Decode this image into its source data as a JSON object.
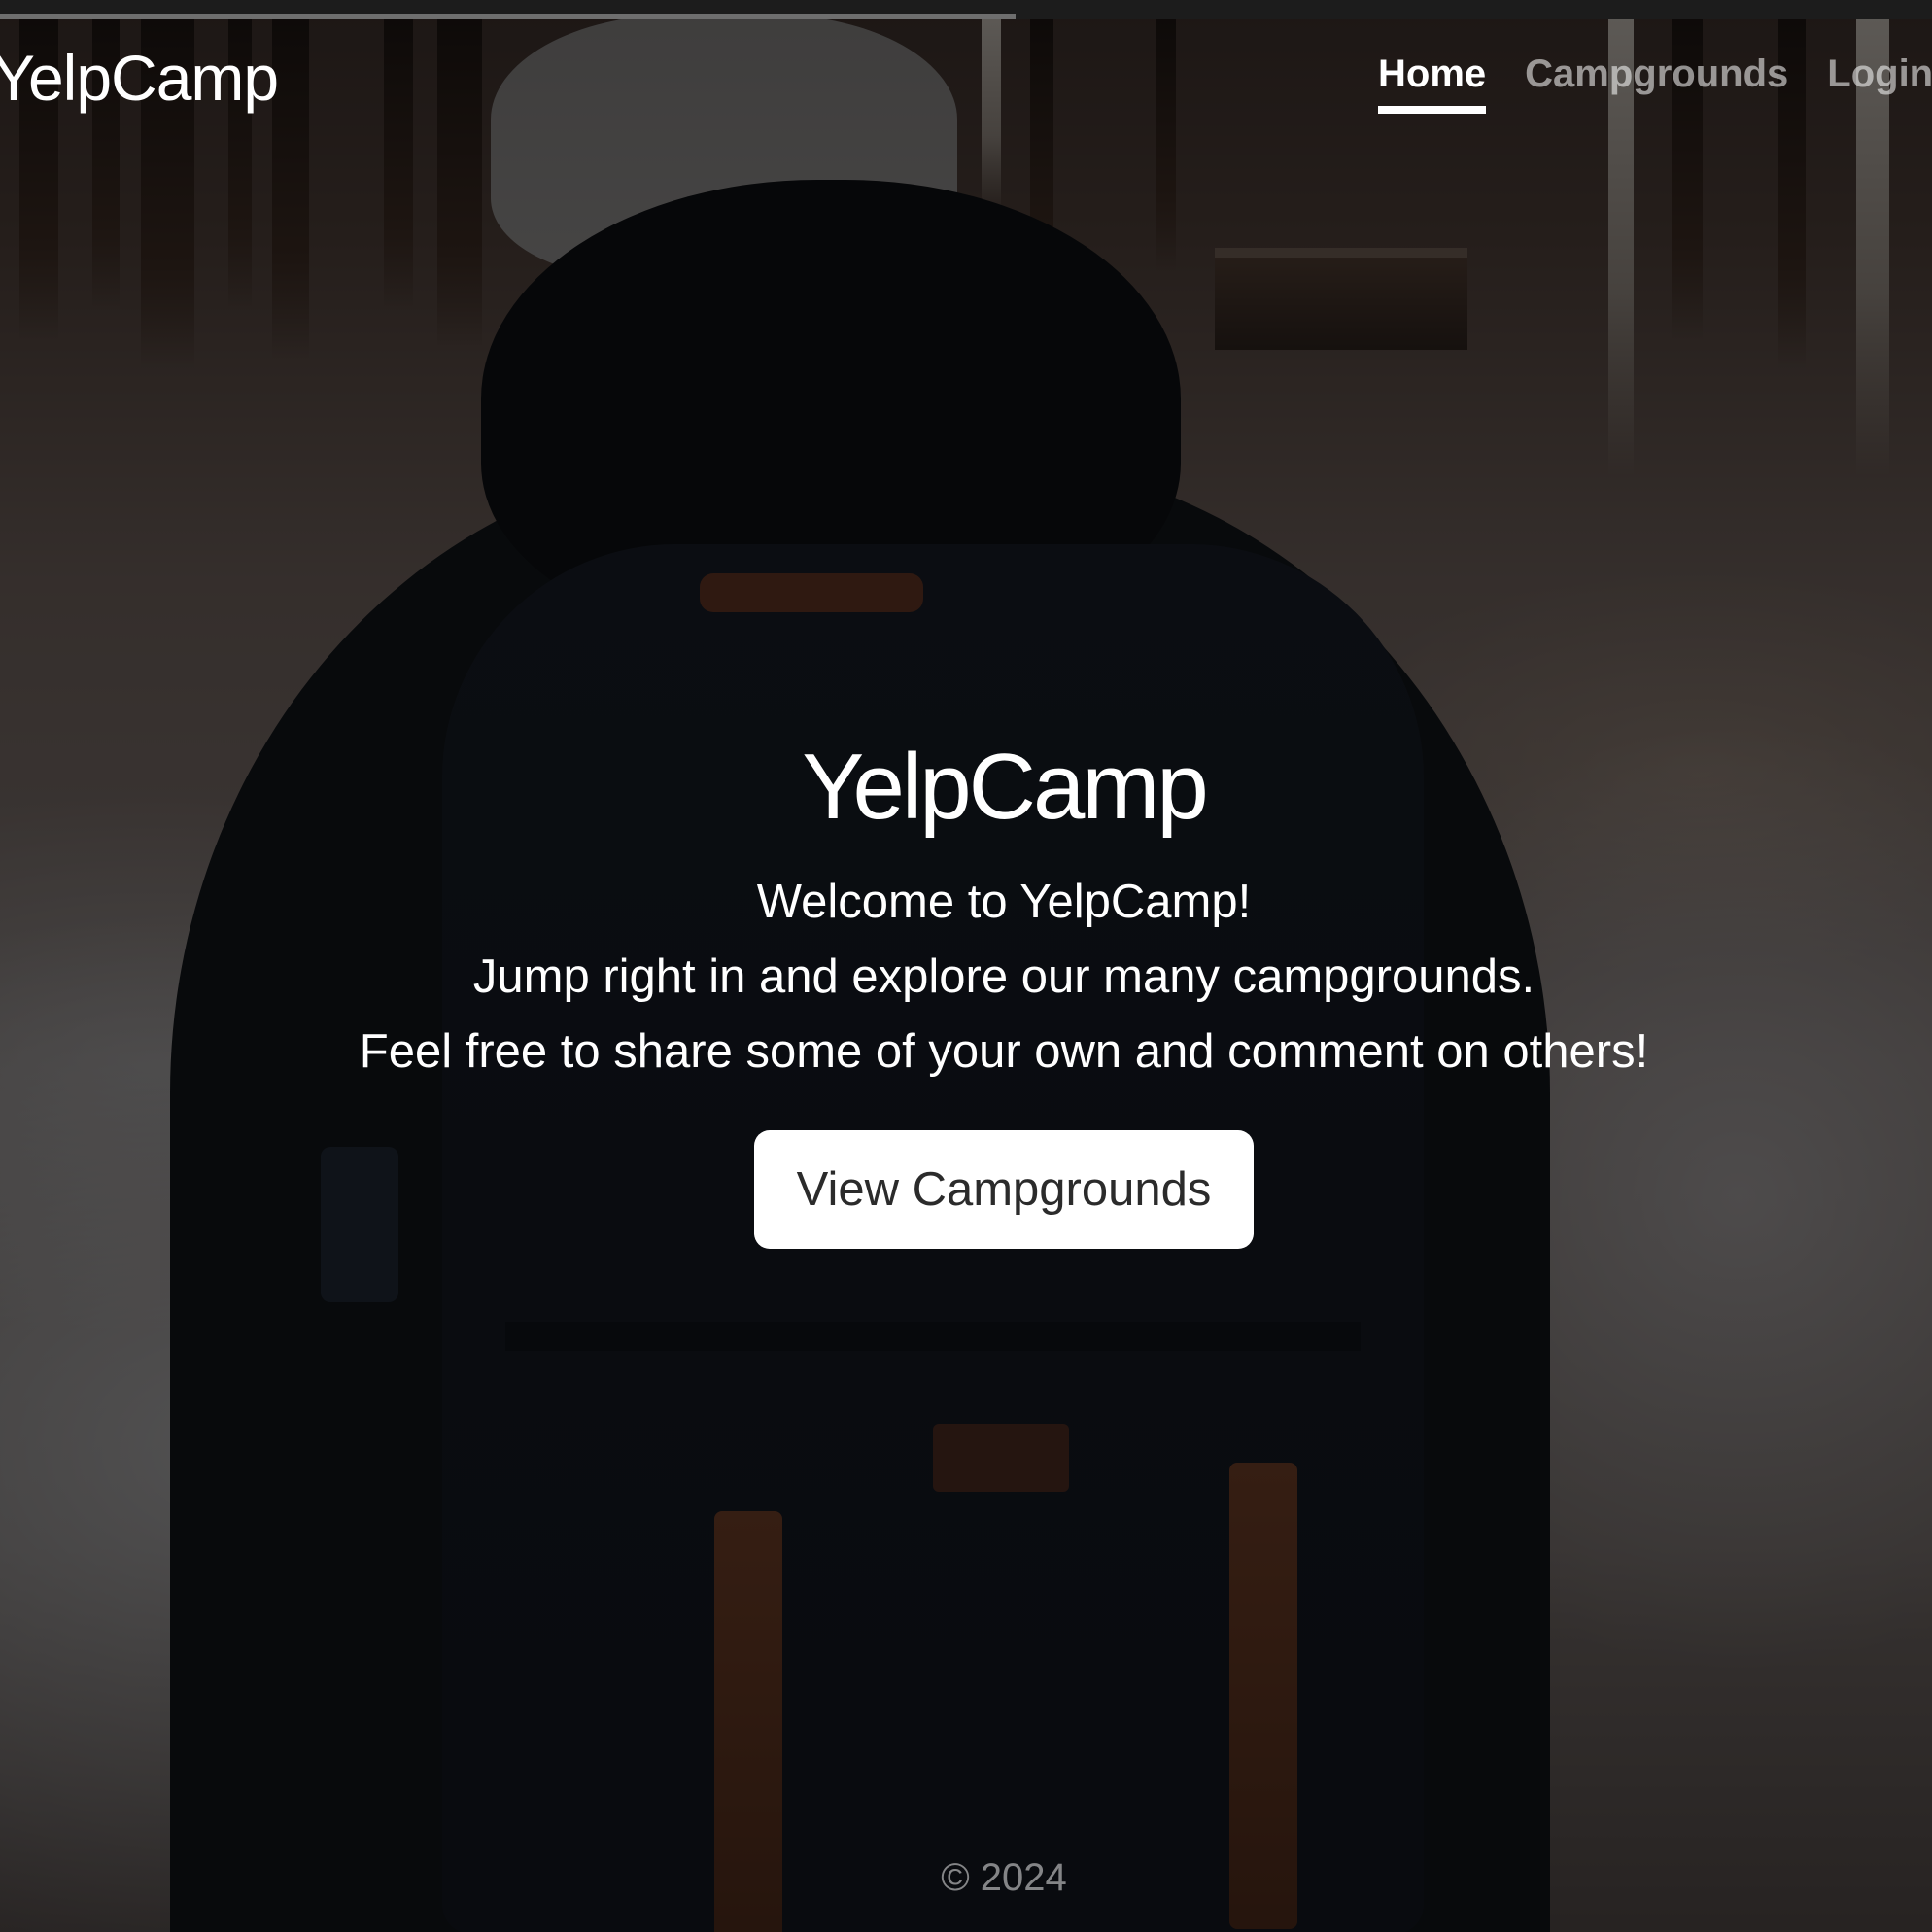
{
  "brand": {
    "name": "YelpCamp"
  },
  "nav": {
    "items": [
      {
        "label": "Home",
        "active": true
      },
      {
        "label": "Campgrounds",
        "active": false
      },
      {
        "label": "Login",
        "active": false
      }
    ]
  },
  "hero": {
    "title": "YelpCamp",
    "lines": [
      "Welcome to YelpCamp!",
      "Jump right in and explore our many campgrounds.",
      "Feel free to share some of your own and comment on others!"
    ],
    "cta_label": "View Campgrounds"
  },
  "footer": {
    "text": "© 2024"
  },
  "colors": {
    "overlay": "#000000",
    "text": "#ffffff",
    "button_bg": "#ffffff",
    "button_text": "#2b2b2b"
  }
}
